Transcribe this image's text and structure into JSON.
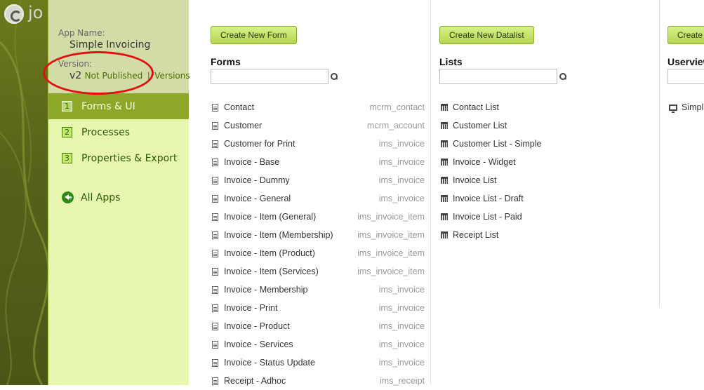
{
  "brand": {
    "logo_text": "jo"
  },
  "sidebar": {
    "app_name_label": "App Name:",
    "app_name": "Simple Invoicing",
    "version_label": "Version:",
    "version": "v2",
    "not_published": "Not Published",
    "separator": "|",
    "versions_link": "Versions",
    "nav": [
      {
        "num": "1",
        "label": "Forms & UI"
      },
      {
        "num": "2",
        "label": "Processes"
      },
      {
        "num": "3",
        "label": "Properties & Export"
      }
    ],
    "all_apps": "All Apps"
  },
  "forms": {
    "create_label": "Create New Form",
    "title": "Forms",
    "search_placeholder": "",
    "items": [
      {
        "name": "Contact",
        "table": "mcrm_contact"
      },
      {
        "name": "Customer",
        "table": "mcrm_account"
      },
      {
        "name": "Customer for Print",
        "table": "ims_invoice"
      },
      {
        "name": "Invoice - Base",
        "table": "ims_invoice"
      },
      {
        "name": "Invoice - Dummy",
        "table": "ims_invoice"
      },
      {
        "name": "Invoice - General",
        "table": "ims_invoice"
      },
      {
        "name": "Invoice - Item (General)",
        "table": "ims_invoice_item"
      },
      {
        "name": "Invoice - Item (Membership)",
        "table": "ims_invoice_item"
      },
      {
        "name": "Invoice - Item (Product)",
        "table": "ims_invoice_item"
      },
      {
        "name": "Invoice - Item (Services)",
        "table": "ims_invoice_item"
      },
      {
        "name": "Invoice - Membership",
        "table": "ims_invoice"
      },
      {
        "name": "Invoice - Print",
        "table": "ims_invoice"
      },
      {
        "name": "Invoice - Product",
        "table": "ims_invoice"
      },
      {
        "name": "Invoice - Services",
        "table": "ims_invoice"
      },
      {
        "name": "Invoice - Status Update",
        "table": "ims_invoice"
      },
      {
        "name": "Receipt - Adhoc",
        "table": "ims_receipt"
      }
    ]
  },
  "lists": {
    "create_label": "Create New Datalist",
    "title": "Lists",
    "search_placeholder": "",
    "items": [
      "Contact List",
      "Customer List",
      "Customer List - Simple",
      "Invoice - Widget",
      "Invoice List",
      "Invoice List - Draft",
      "Invoice List - Paid",
      "Receipt List"
    ]
  },
  "userviews": {
    "create_label": "Create",
    "title": "Userviews",
    "items": [
      "Simpl"
    ]
  }
}
